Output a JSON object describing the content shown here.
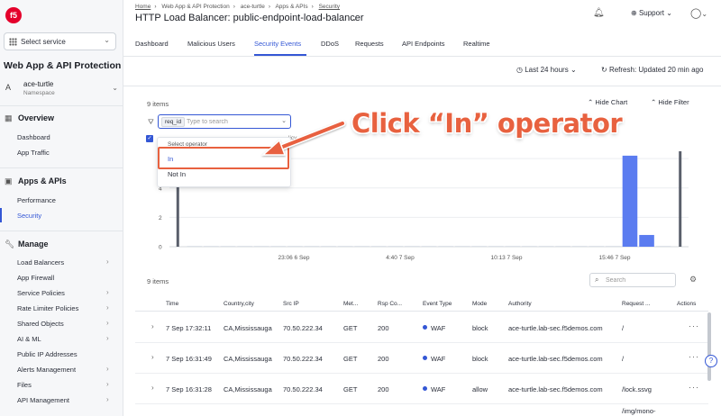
{
  "sidebar": {
    "logo": "f5",
    "service_select": "Select service",
    "app_title": "Web App & API Protection",
    "namespace": {
      "avatar": "A",
      "name": "ace-turtle",
      "label": "Namespace"
    },
    "sections": [
      {
        "title": "Overview",
        "items": [
          "Dashboard",
          "App Traffic"
        ]
      },
      {
        "title": "Apps & APIs",
        "items": [
          "Performance",
          "Security"
        ]
      },
      {
        "title": "Manage",
        "items": [
          "Load Balancers",
          "App Firewall",
          "Service Policies",
          "Rate Limiter Policies",
          "Shared Objects",
          "AI & ML",
          "Public IP Addresses",
          "Alerts Management",
          "Files",
          "API Management"
        ]
      }
    ]
  },
  "header": {
    "breadcrumbs": [
      "Home",
      "Web App & API Protection",
      "ace-turtle",
      "Apps & APIs",
      "Security"
    ],
    "title": "HTTP Load Balancer: public-endpoint-load-balancer",
    "support": "Support",
    "tabs": [
      "Dashboard",
      "Malicious Users",
      "Security Events",
      "DDoS",
      "Requests",
      "API Endpoints",
      "Realtime"
    ],
    "active_tab": "Security Events",
    "time_range": "Last 24 hours",
    "refresh": "Refresh: Updated 20 min ago"
  },
  "chart_panel": {
    "items_count": "9 items",
    "hide_chart": "Hide Chart",
    "hide_filter": "Hide Filter",
    "filter_chip": "req_id",
    "filter_placeholder": "Type to search",
    "dropdown": {
      "header": "Select operator",
      "options": [
        "In",
        "Not In"
      ]
    },
    "legend_fragment": "licy",
    "callout": "Click “In” operator"
  },
  "chart_data": {
    "type": "bar",
    "yticks": [
      "6.5",
      "6",
      "4",
      "2",
      "0"
    ],
    "ylim": [
      0,
      6.5
    ],
    "xticks": [
      "23:06 6 Sep",
      "4:40 7 Sep",
      "10:13 7 Sep",
      "15:46 7 Sep"
    ],
    "values": [
      6.5,
      0,
      0,
      0,
      0,
      0,
      0,
      0,
      0,
      0,
      0,
      0,
      0,
      0,
      0,
      0,
      0,
      0,
      0,
      0,
      0,
      0,
      0,
      0,
      0,
      0,
      0,
      6.2,
      0.8,
      0,
      6.5
    ],
    "grid": true
  },
  "table": {
    "items_count": "9 items",
    "search_placeholder": "Search",
    "columns": [
      "Time",
      "Country,city",
      "Src IP",
      "Met...",
      "Rsp Co...",
      "Event Type",
      "Mode",
      "Authority",
      "Request ...",
      "Actions"
    ],
    "rows": [
      {
        "time": "7 Sep 17:32:11",
        "country": "CA,Mississauga",
        "ip": "70.50.222.34",
        "method": "GET",
        "rsp": "200",
        "event": "WAF",
        "mode": "block",
        "authority": "ace-turtle.lab-sec.f5demos.com",
        "request": "/"
      },
      {
        "time": "7 Sep 16:31:49",
        "country": "CA,Mississauga",
        "ip": "70.50.222.34",
        "method": "GET",
        "rsp": "200",
        "event": "WAF",
        "mode": "block",
        "authority": "ace-turtle.lab-sec.f5demos.com",
        "request": "/"
      },
      {
        "time": "7 Sep 16:31:28",
        "country": "CA,Mississauga",
        "ip": "70.50.222.34",
        "method": "GET",
        "rsp": "200",
        "event": "WAF",
        "mode": "allow",
        "authority": "ace-turtle.lab-sec.f5demos.com",
        "request": "/lock.ssvg"
      }
    ],
    "partial_request": "/img/mono-"
  }
}
